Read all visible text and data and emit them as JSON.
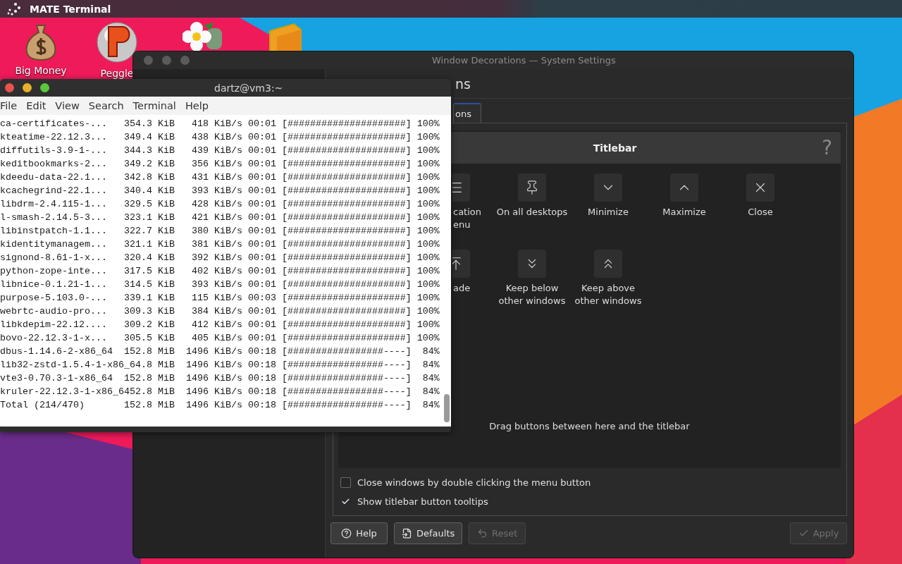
{
  "top_bar": {
    "title": "MATE Terminal"
  },
  "desktop_icons": [
    {
      "label": "Big Money",
      "kind": "money-bag"
    },
    {
      "label": "Peggle",
      "kind": "ball"
    },
    {
      "kind": "flower"
    },
    {
      "kind": "block"
    }
  ],
  "settings_window": {
    "title": "Window Decorations — System Settings",
    "heading": "ns",
    "tabs": [
      {
        "label": "ons",
        "selected": true
      }
    ],
    "panel_title": "Titlebar",
    "help_mark": "?",
    "button_rows": [
      [
        {
          "label": "cation\nenu",
          "kind": "menu"
        },
        {
          "label": "On all desktops",
          "kind": "pin"
        },
        {
          "label": "Minimize",
          "kind": "minimize"
        },
        {
          "label": "Maximize",
          "kind": "maximize"
        },
        {
          "label": "Close",
          "kind": "close"
        }
      ],
      [
        {
          "label": "ade",
          "kind": "shade"
        },
        {
          "label": "Keep below\nother windows",
          "kind": "keep-below"
        },
        {
          "label": "Keep above\nother windows",
          "kind": "keep-above"
        }
      ]
    ],
    "drop_hint": "Drag buttons between here and the titlebar",
    "options": [
      {
        "label": "Close windows by double clicking the menu button",
        "checked": false
      },
      {
        "label": "Show titlebar button tooltips",
        "checked": true
      }
    ],
    "buttons": [
      {
        "label": "Help",
        "kind": "help",
        "disabled": false
      },
      {
        "label": "Defaults",
        "kind": "defaults",
        "disabled": false
      },
      {
        "label": "Reset",
        "kind": "reset",
        "disabled": true
      }
    ],
    "apply_button": {
      "label": "Apply",
      "kind": "apply",
      "disabled": true
    }
  },
  "terminal": {
    "title": "dartz@vm3:~",
    "menu": [
      "File",
      "Edit",
      "View",
      "Search",
      "Terminal",
      "Help"
    ],
    "lines": [
      "ca-certificates-...   354.3 KiB   418 KiB/s 00:01 [#####################] 100%",
      "kteatime-22.12.3...   349.4 KiB   438 KiB/s 00:01 [#####################] 100%",
      "diffutils-3.9-1-...   344.3 KiB   439 KiB/s 00:01 [#####################] 100%",
      "keditbookmarks-2...   349.2 KiB   356 KiB/s 00:01 [#####################] 100%",
      "kdeedu-data-22.1...   342.8 KiB   431 KiB/s 00:01 [#####################] 100%",
      "kcachegrind-22.1...   340.4 KiB   393 KiB/s 00:01 [#####################] 100%",
      "libdrm-2.4.115-1...   329.5 KiB   428 KiB/s 00:01 [#####################] 100%",
      "l-smash-2.14.5-3...   323.1 KiB   421 KiB/s 00:01 [#####################] 100%",
      "libinstpatch-1.1...   322.7 KiB   380 KiB/s 00:01 [#####################] 100%",
      "kidentitymanagem...   321.1 KiB   381 KiB/s 00:01 [#####################] 100%",
      "signond-8.61-1-x...   320.4 KiB   392 KiB/s 00:01 [#####################] 100%",
      "python-zope-inte...   317.5 KiB   402 KiB/s 00:01 [#####################] 100%",
      "libnice-0.1.21-1...   314.5 KiB   393 KiB/s 00:01 [#####################] 100%",
      "purpose-5.103.0-...   339.1 KiB   115 KiB/s 00:03 [#####################] 100%",
      "webrtc-audio-pro...   309.3 KiB   384 KiB/s 00:01 [#####################] 100%",
      "libkdepim-22.12....   309.2 KiB   412 KiB/s 00:01 [#####################] 100%",
      "bovo-22.12.3-1-x...   305.5 KiB   405 KiB/s 00:01 [#####################] 100%",
      "dbus-1.14.6-2-x86_64  152.8 MiB  1496 KiB/s 00:18 [#################----]  84%",
      "lib32-zstd-1.5.4-1-x86_64.8 MiB  1496 KiB/s 00:18 [#################----]  84%",
      "vte3-0.70.3-1-x86_64  152.8 MiB  1496 KiB/s 00:18 [#################----]  84%",
      "kruler-22.12.3-1-x86_6452.8 MiB  1496 KiB/s 00:18 [#################----]  84%",
      "Total (214/470)       152.8 MiB  1496 KiB/s 00:18 [#################----]  84%"
    ]
  }
}
